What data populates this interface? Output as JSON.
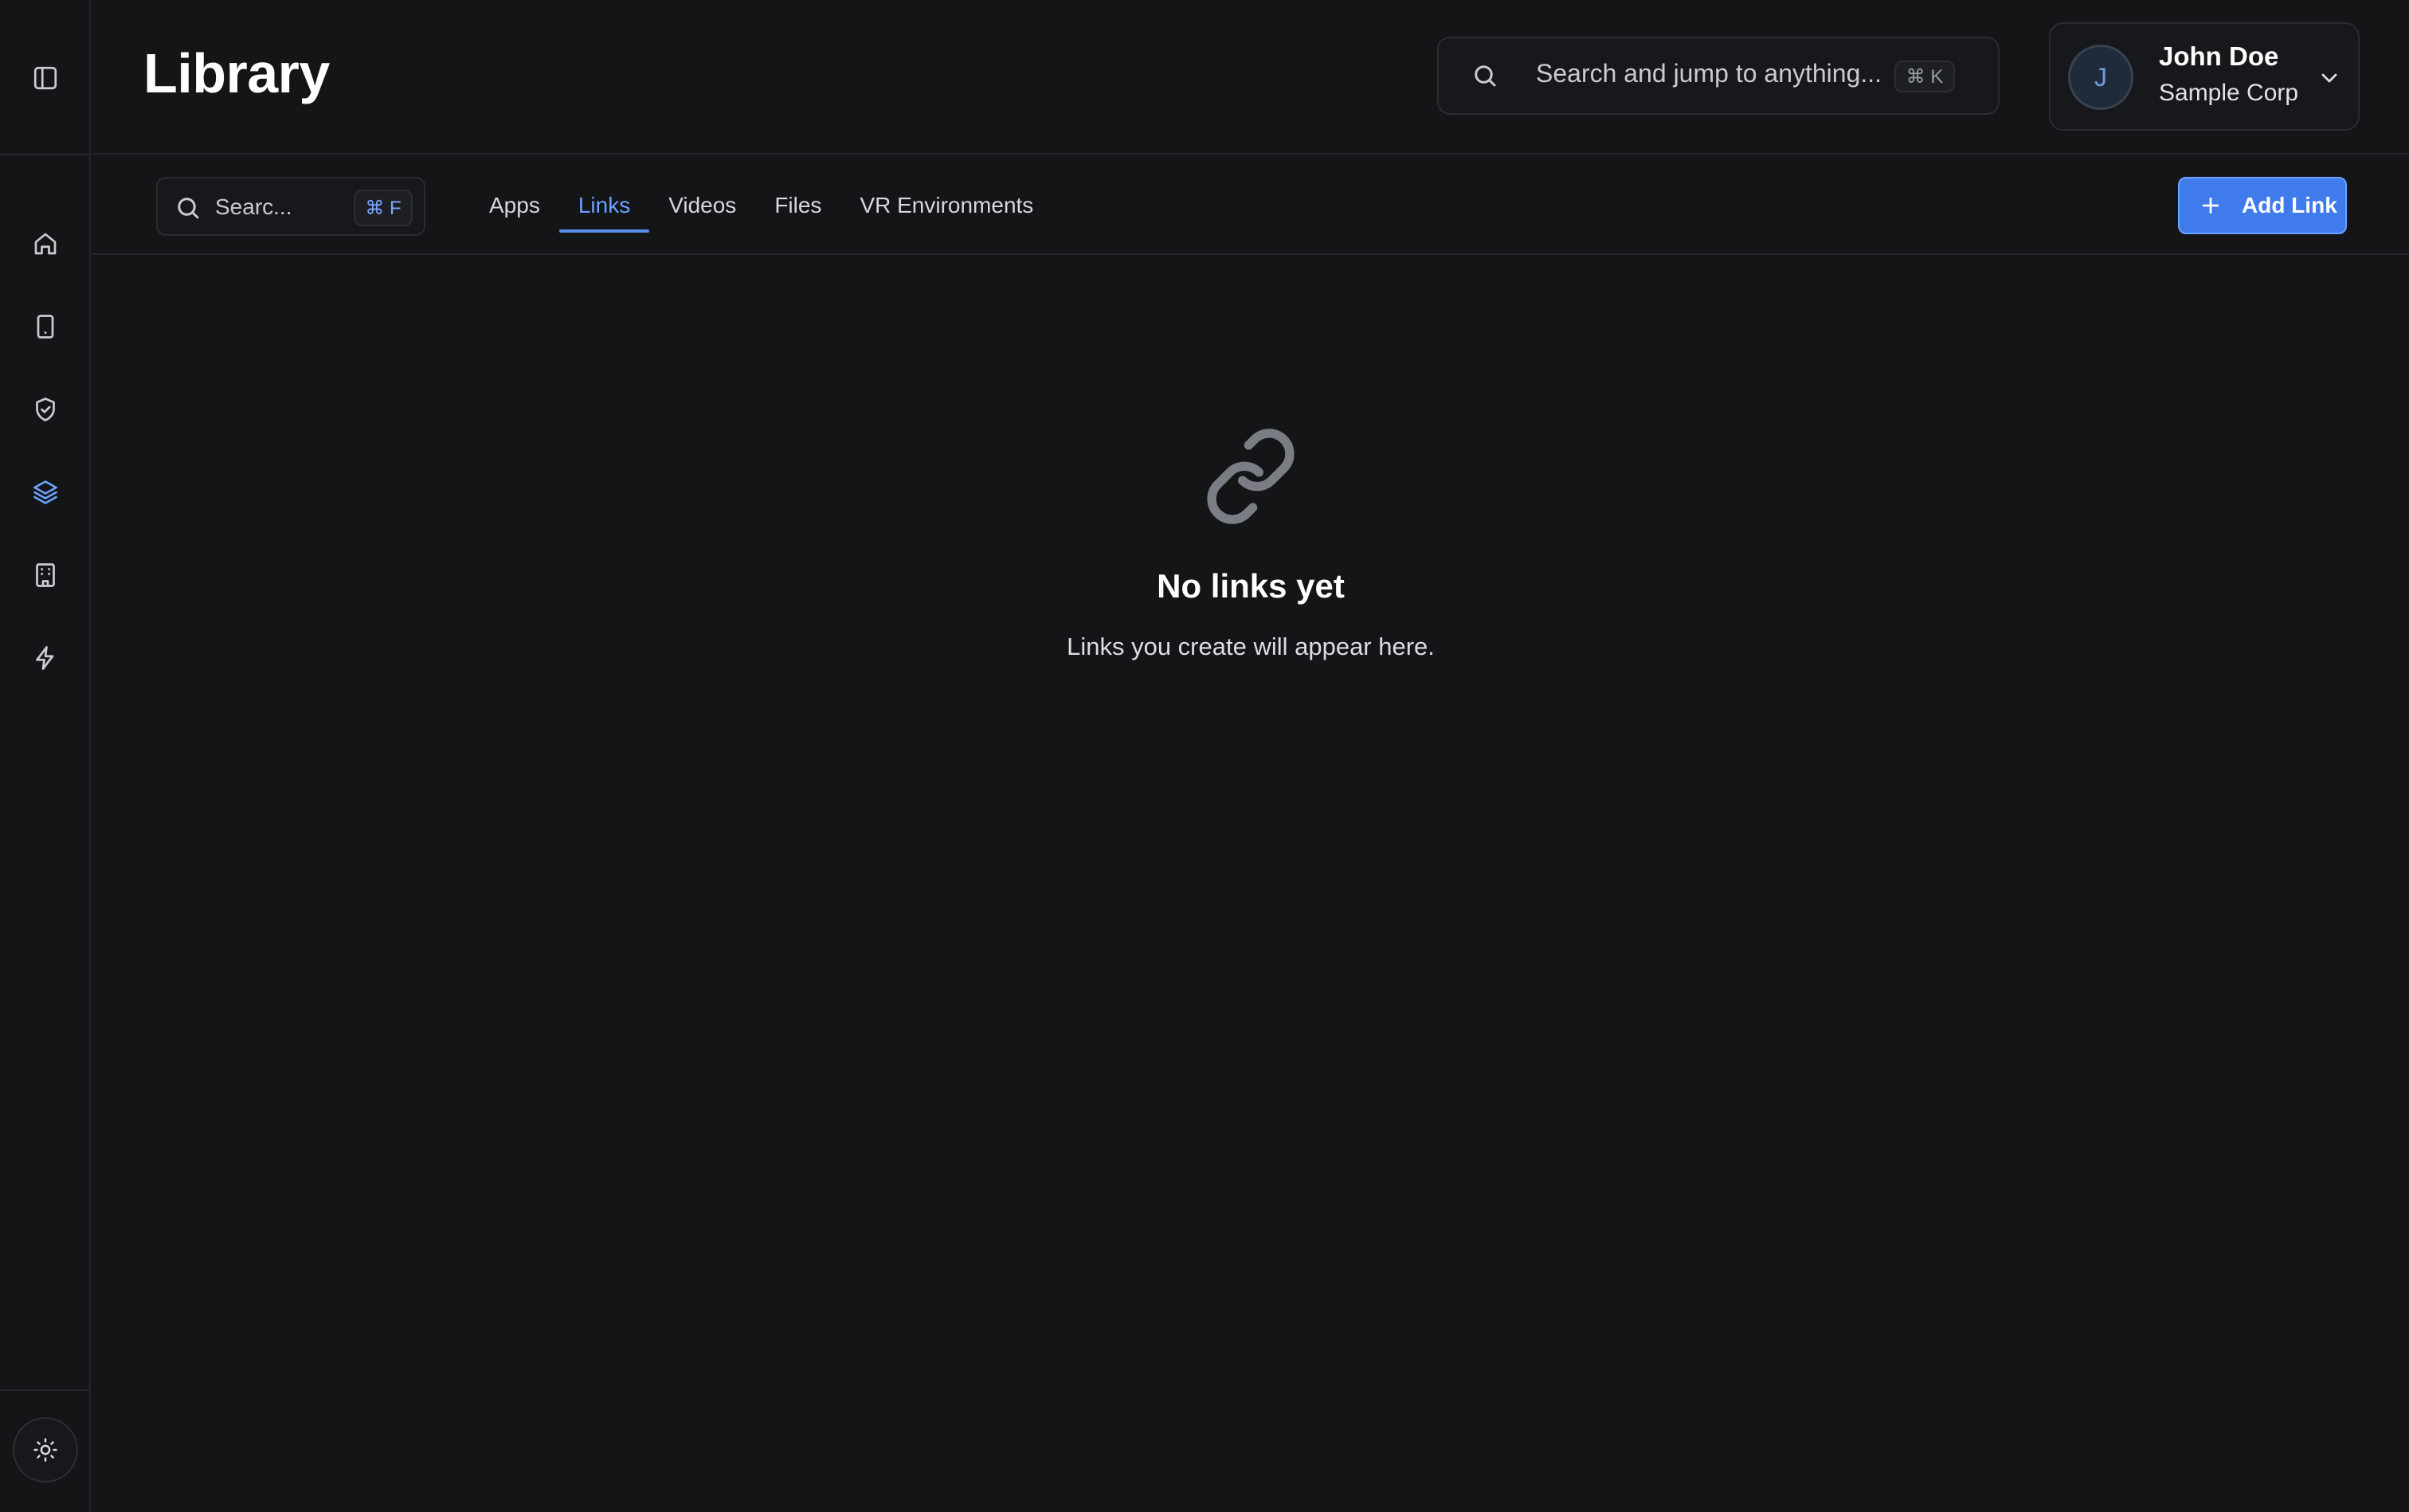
{
  "header": {
    "title": "Library",
    "global_search_placeholder": "Search and jump to anything...",
    "global_search_shortcut": "⌘ K"
  },
  "user": {
    "initial": "J",
    "name": "John Doe",
    "org": "Sample Corp"
  },
  "sidebar": {
    "toggle_icon": "sidebar-panel-icon",
    "items": [
      {
        "icon": "home-icon",
        "active": false
      },
      {
        "icon": "device-icon",
        "active": false
      },
      {
        "icon": "shield-check-icon",
        "active": false
      },
      {
        "icon": "layers-icon",
        "active": true
      },
      {
        "icon": "building-icon",
        "active": false
      },
      {
        "icon": "lightning-icon",
        "active": false
      }
    ],
    "theme_icon": "sun-icon"
  },
  "toolbar": {
    "search_placeholder": "Searc...",
    "search_shortcut": "⌘ F",
    "tabs": [
      {
        "label": "Apps",
        "active": false
      },
      {
        "label": "Links",
        "active": true
      },
      {
        "label": "Videos",
        "active": false
      },
      {
        "label": "Files",
        "active": false
      },
      {
        "label": "VR Environments",
        "active": false
      }
    ],
    "add_label": "Add Link"
  },
  "empty_state": {
    "icon": "link-icon",
    "title": "No links yet",
    "subtitle": "Links you create will appear here."
  },
  "colors": {
    "background": "#141517",
    "accent": "#3f7bea",
    "active_tab": "#6aa2ff"
  }
}
